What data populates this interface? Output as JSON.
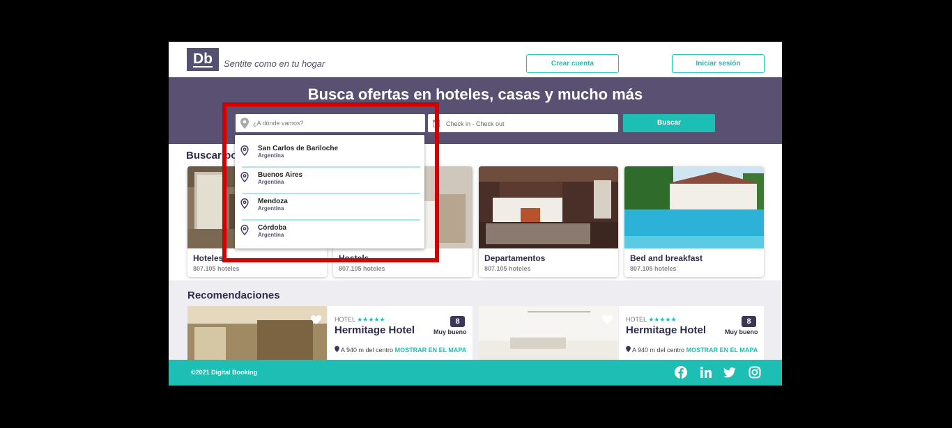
{
  "header": {
    "logo": "Db",
    "tagline": "Sentite como en tu hogar",
    "create_account": "Crear cuenta",
    "login": "Iniciar sesión"
  },
  "hero": {
    "title": "Busca ofertas en hoteles, casas y mucho más",
    "destination_placeholder": "¿A dónde vamos?",
    "dates_placeholder": "Check in - Check out",
    "search_button": "Buscar"
  },
  "categories": {
    "title": "Buscar po",
    "items": [
      {
        "name": "Hoteles",
        "count": "807.105 hoteles"
      },
      {
        "name": "Hostels",
        "count": "807.105 hoteles"
      },
      {
        "name": "Departamentos",
        "count": "807.105 hoteles"
      },
      {
        "name": "Bed and breakfast",
        "count": "807.105 hoteles"
      }
    ]
  },
  "recommendations": {
    "title": "Recomendaciones",
    "items": [
      {
        "category": "HOTEL",
        "stars": "★★★★★",
        "name": "Hermitage Hotel",
        "score": "8",
        "rating": "Muy bueno",
        "distance": "A 940 m del centro",
        "map_link": "MOSTRAR EN EL MAPA"
      },
      {
        "category": "HOTEL",
        "stars": "★★★★★",
        "name": "Hermitage Hotel",
        "score": "8",
        "rating": "Muy bueno",
        "distance": "A 940 m del centro",
        "map_link": "MOSTRAR EN EL MAPA"
      }
    ]
  },
  "dropdown": {
    "items": [
      {
        "city": "San Carlos de Bariloche",
        "country": "Argentina"
      },
      {
        "city": "Buenos Aires",
        "country": "Argentina"
      },
      {
        "city": "Mendoza",
        "country": "Argentina"
      },
      {
        "city": "Córdoba",
        "country": "Argentina"
      }
    ]
  },
  "footer": {
    "copyright": "©2021 Digital Booking",
    "social_icons": [
      "facebook-icon",
      "linkedin-icon",
      "twitter-icon",
      "instagram-icon"
    ]
  },
  "colors": {
    "primary": "#5a5172",
    "accent": "#1dbeb4",
    "highlight": "#d40000"
  }
}
